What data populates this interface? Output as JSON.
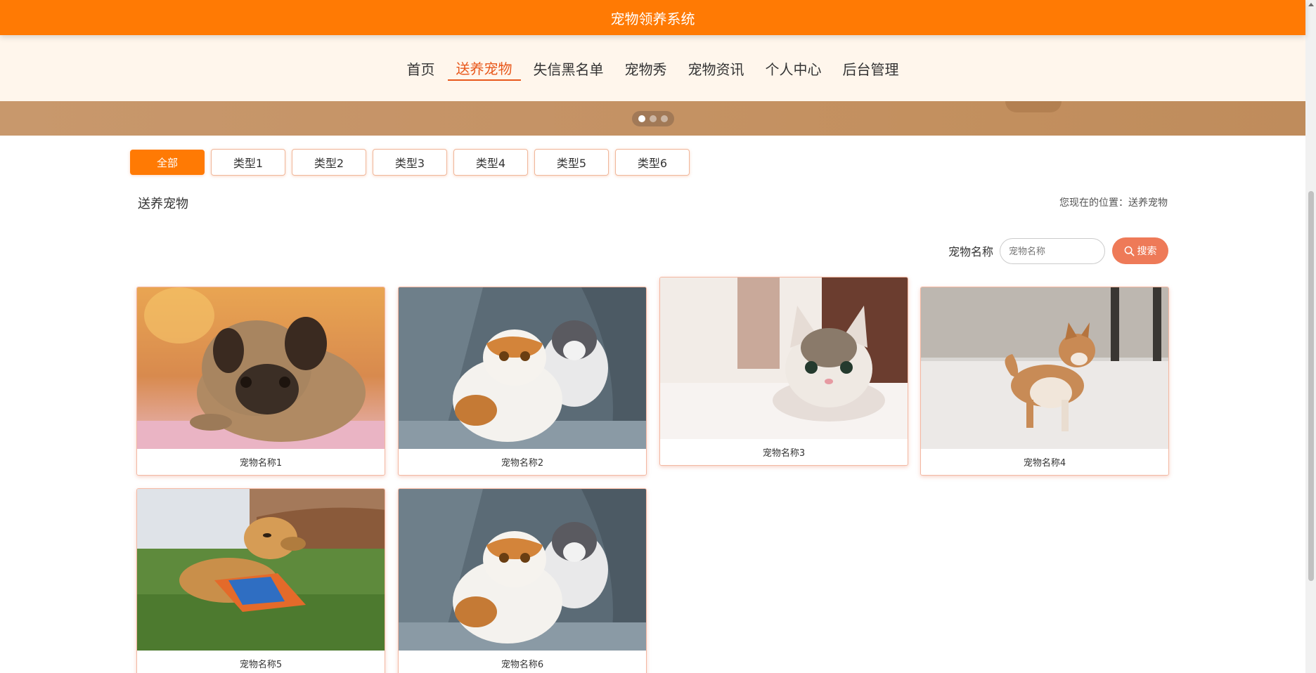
{
  "header": {
    "title": "宠物领养系统"
  },
  "nav": [
    {
      "label": "首页"
    },
    {
      "label": "送养宠物",
      "active": true
    },
    {
      "label": "失信黑名单"
    },
    {
      "label": "宠物秀"
    },
    {
      "label": "宠物资讯"
    },
    {
      "label": "个人中心"
    },
    {
      "label": "后台管理"
    }
  ],
  "carousel": {
    "slides": 3,
    "current": 1
  },
  "types": [
    {
      "label": "全部",
      "active": true
    },
    {
      "label": "类型1"
    },
    {
      "label": "类型2"
    },
    {
      "label": "类型3"
    },
    {
      "label": "类型4"
    },
    {
      "label": "类型5"
    },
    {
      "label": "类型6"
    }
  ],
  "section": {
    "title": "送养宠物",
    "breadcrumb": "您现在的位置：送养宠物"
  },
  "search": {
    "label": "宠物名称",
    "placeholder": "宠物名称",
    "button": "搜索"
  },
  "pets": [
    {
      "name": "宠物名称1",
      "image": "pug-icon"
    },
    {
      "name": "宠物名称2",
      "image": "two-cats-icon"
    },
    {
      "name": "宠物名称3",
      "image": "kitten-icon"
    },
    {
      "name": "宠物名称4",
      "image": "shiba-icon"
    },
    {
      "name": "宠物名称5",
      "image": "golden-retriever-icon"
    },
    {
      "name": "宠物名称6",
      "image": "two-cats-icon"
    }
  ],
  "colors": {
    "primary": "#ff7a04",
    "accent": "#e8581b",
    "search_button": "#ee7a58",
    "nav_bg": "#fff6ec"
  }
}
